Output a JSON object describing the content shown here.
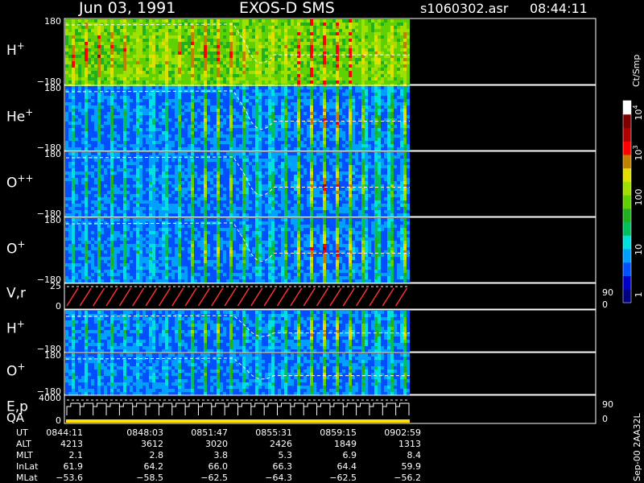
{
  "header": {
    "date": "Jun 03, 1991",
    "instrument": "EXOS-D SMS",
    "file": "s1060302.asr",
    "time": "08:44:11"
  },
  "colorbar": {
    "unit": "Ct/Smp",
    "tick_labels": [
      "1",
      "10",
      "100",
      "10",
      "10"
    ],
    "exponents": [
      "",
      "",
      "",
      "3",
      "4"
    ]
  },
  "version_label": "Sep-00 2AA32L",
  "chart_data": {
    "type": "heatmap",
    "panels": [
      {
        "name": "H",
        "charge": "+",
        "kind": "spectrogram",
        "ylim": [
          -180,
          180
        ],
        "ytick_top": "180",
        "ytick_bottom": "−180",
        "scale": 1.35
      },
      {
        "name": "He",
        "charge": "+",
        "kind": "spectrogram",
        "ylim": [
          -180,
          180
        ],
        "ytick_top": "180",
        "ytick_bottom": "−180",
        "scale": 0.95
      },
      {
        "name": "O",
        "charge": "++",
        "kind": "spectrogram",
        "ylim": [
          -180,
          180
        ],
        "ytick_top": "180",
        "ytick_bottom": "−180",
        "scale": 0.95
      },
      {
        "name": "O",
        "charge": "+",
        "kind": "spectrogram",
        "ylim": [
          -180,
          180
        ],
        "ytick_top": "180",
        "ytick_bottom": "−180",
        "scale": 1.0
      },
      {
        "name": "V,r",
        "charge": "",
        "kind": "sawtooth",
        "ylim": [
          0,
          25
        ],
        "ytick_top": "25",
        "ytick_bottom": "0",
        "right_top": "90",
        "right_bottom": "0",
        "cycles": 26
      },
      {
        "name": "H",
        "charge": "+",
        "kind": "spectrogram",
        "ylim": [
          -180,
          180
        ],
        "ytick_top": "",
        "ytick_bottom": "−180",
        "scale": 0.9
      },
      {
        "name": "O",
        "charge": "+",
        "kind": "spectrogram",
        "ylim": [
          -180,
          180
        ],
        "ytick_top": "180",
        "ytick_bottom": "−180",
        "scale": 0.65
      },
      {
        "name": "E,p",
        "name2": "QA",
        "charge": "",
        "kind": "steps",
        "ylim": [
          0,
          4000
        ],
        "ytick_top": "4000",
        "ytick_bottom": "0",
        "right_top": "90",
        "right_bottom": "0",
        "cycles": 26
      }
    ],
    "time_axis": {
      "labels": [
        "UT",
        "ALT",
        "MLT",
        "InLat",
        "MLat"
      ],
      "columns": [
        {
          "UT": "0844:11",
          "ALT": "4213",
          "MLT": "2.1",
          "InLat": "61.9",
          "MLat": "−53.6"
        },
        {
          "UT": "0848:03",
          "ALT": "3612",
          "MLT": "2.8",
          "InLat": "64.2",
          "MLat": "−58.5"
        },
        {
          "UT": "0851:47",
          "ALT": "3020",
          "MLT": "3.8",
          "InLat": "66.0",
          "MLat": "−62.5"
        },
        {
          "UT": "0855:31",
          "ALT": "2426",
          "MLT": "5.3",
          "InLat": "66.3",
          "MLat": "−64.3"
        },
        {
          "UT": "0859:15",
          "ALT": "1849",
          "MLT": "6.9",
          "InLat": "64.4",
          "MLat": "−62.5"
        },
        {
          "UT": "0902:59",
          "ALT": "1313",
          "MLT": "8.4",
          "InLat": "59.9",
          "MLat": "−56.2"
        }
      ]
    },
    "colors": [
      "#000080",
      "#0000c8",
      "#0050ff",
      "#00a0ff",
      "#00e0e0",
      "#00c060",
      "#20b020",
      "#60d000",
      "#a0e000",
      "#e0e000",
      "#c08000",
      "#ff0000",
      "#b00000",
      "#800000",
      "#ffffff"
    ]
  }
}
